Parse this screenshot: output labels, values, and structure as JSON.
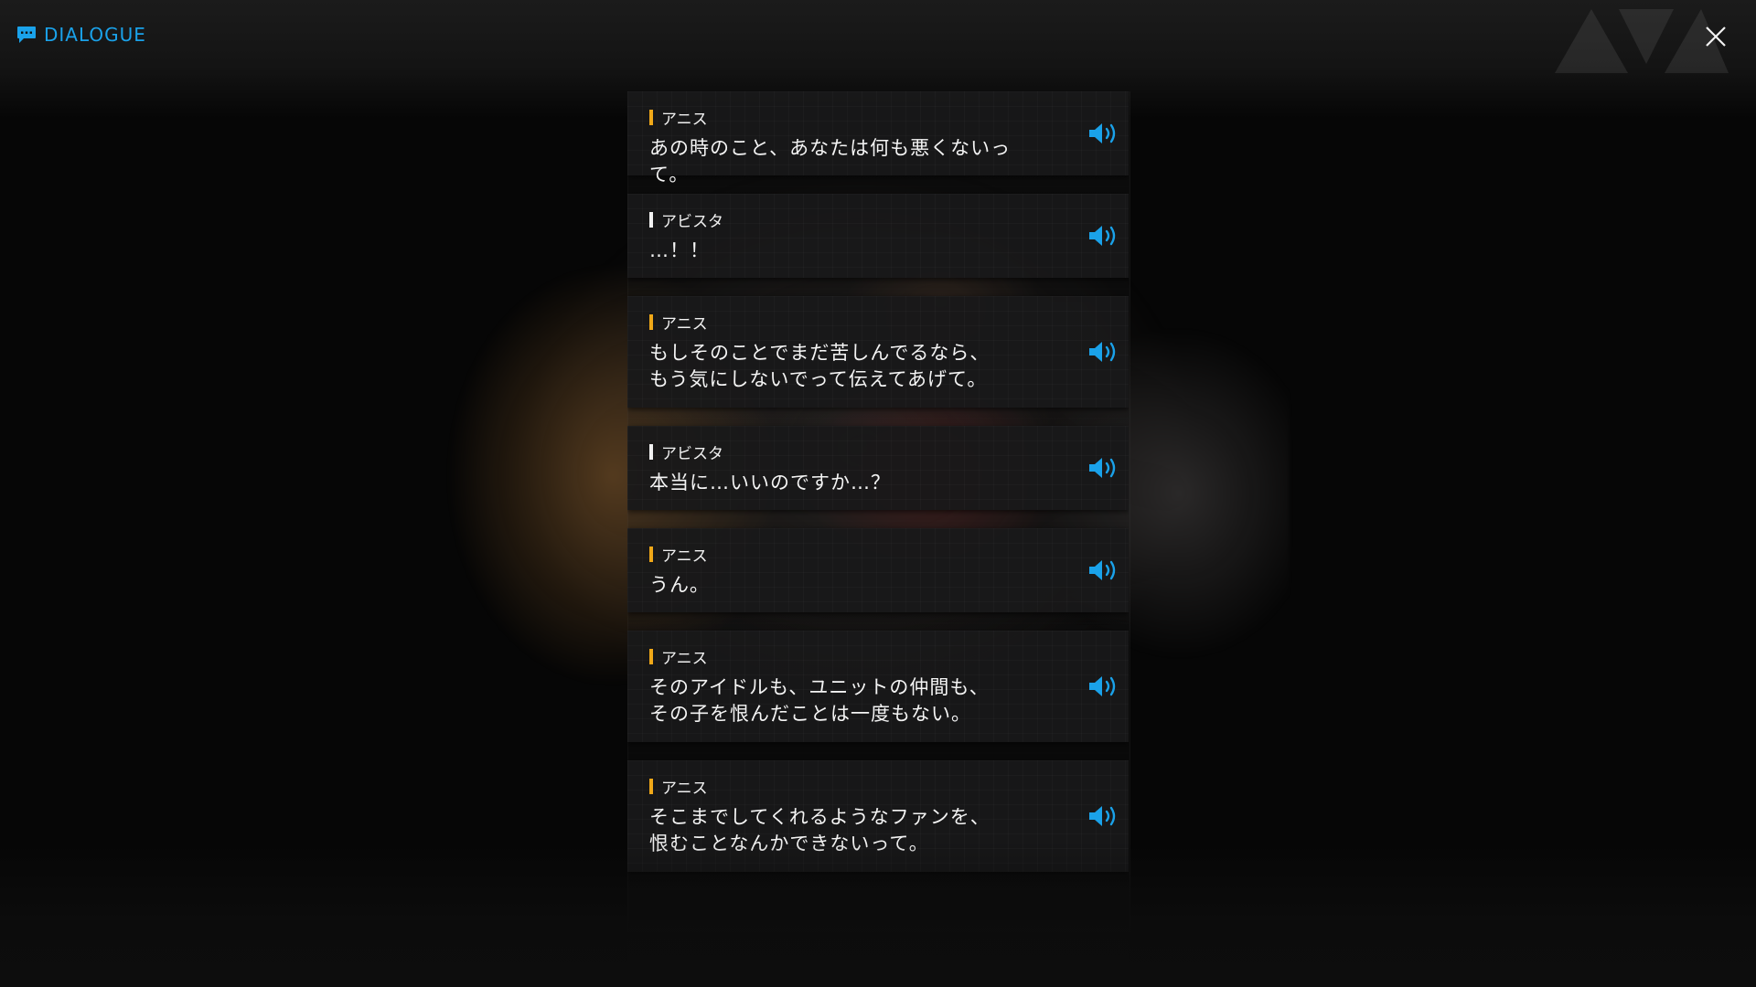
{
  "header": {
    "title": "DIALOGUE",
    "icon": "chat-bubble-icon",
    "accent_color": "#1aa2ea"
  },
  "close_icon": "close-icon",
  "speaker_colors": {
    "アニス": "#f0a818",
    "アビスタ": "#f2f2f2"
  },
  "entries": [
    {
      "speaker": "アニス",
      "text": "あの時のこと、あなたは何も悪くないって。"
    },
    {
      "speaker": "アビスタ",
      "text": "…！！"
    },
    {
      "speaker": "アニス",
      "text": "もしそのことでまだ苦しんでるなら、\nもう気にしないでって伝えてあげて。"
    },
    {
      "speaker": "アビスタ",
      "text": "本当に…いいのですか…？"
    },
    {
      "speaker": "アニス",
      "text": "うん。"
    },
    {
      "speaker": "アニス",
      "text": "そのアイドルも、ユニットの仲間も、\nその子を恨んだことは一度もない。"
    },
    {
      "speaker": "アニス",
      "text": "そこまでしてくれるようなファンを、\n恨むことなんかできないって。"
    }
  ],
  "voice_icon": "speaker-volume-icon"
}
